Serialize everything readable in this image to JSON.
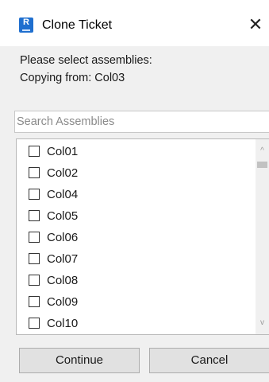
{
  "window": {
    "title": "Clone Ticket",
    "app_icon_letter": "R",
    "close_glyph": "✕"
  },
  "prompt": {
    "line1": "Please select assemblies:",
    "line2": "Copying from: Col03"
  },
  "search": {
    "placeholder": "Search Assemblies",
    "value": ""
  },
  "assemblies": [
    {
      "label": "Col01",
      "checked": false
    },
    {
      "label": "Col02",
      "checked": false
    },
    {
      "label": "Col04",
      "checked": false
    },
    {
      "label": "Col05",
      "checked": false
    },
    {
      "label": "Col06",
      "checked": false
    },
    {
      "label": "Col07",
      "checked": false
    },
    {
      "label": "Col08",
      "checked": false
    },
    {
      "label": "Col09",
      "checked": false
    },
    {
      "label": "Col10",
      "checked": false
    }
  ],
  "scrollbar": {
    "up_glyph": "^",
    "down_glyph": "v"
  },
  "buttons": {
    "continue": "Continue",
    "cancel": "Cancel"
  }
}
